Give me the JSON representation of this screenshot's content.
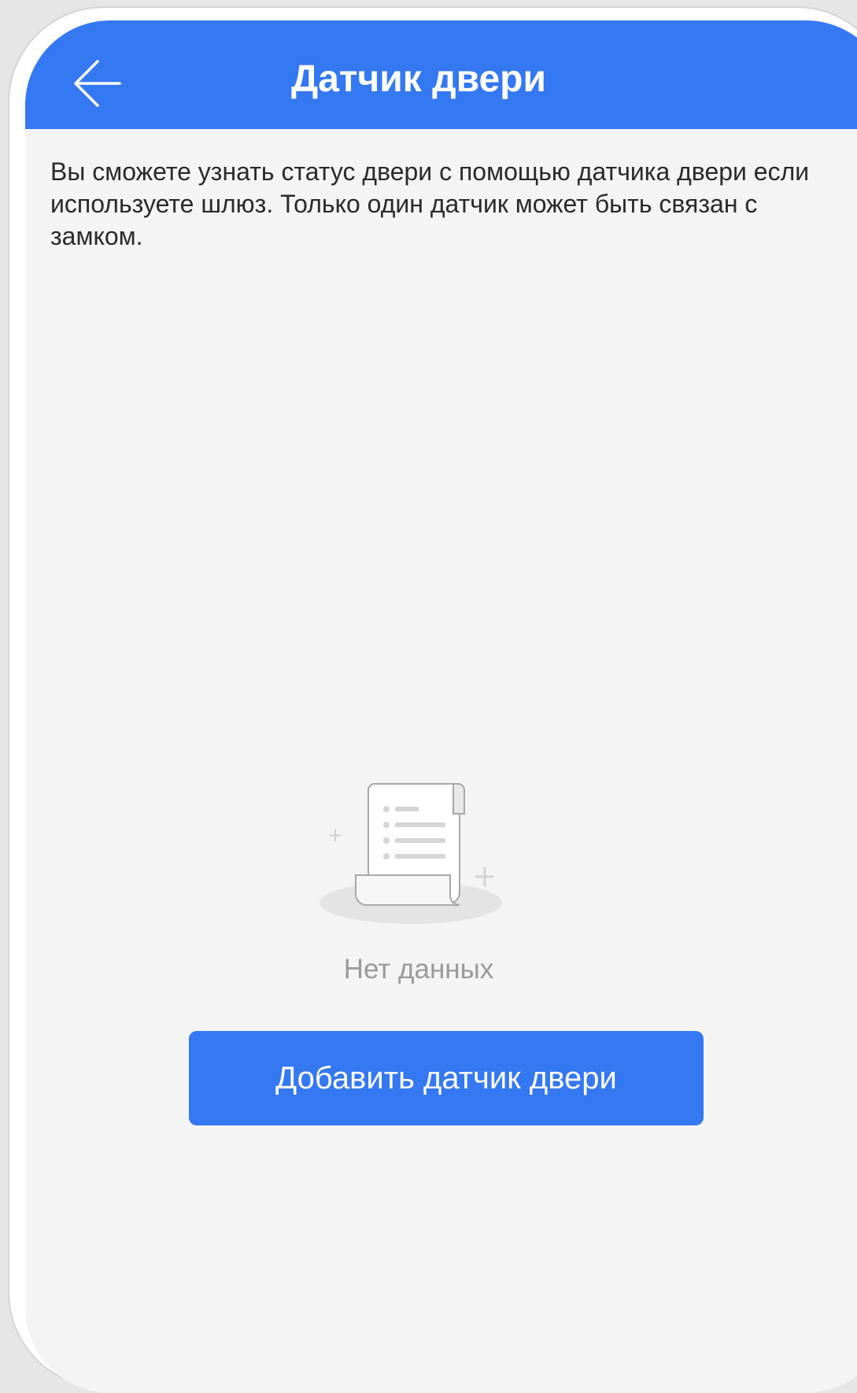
{
  "header": {
    "title": "Датчик двери",
    "back_icon": "arrow-left-icon"
  },
  "description": "Вы сможете узнать статус двери с помощью датчика двери если используете шлюз. Только один датчик может быть связан с замком.",
  "empty_state": {
    "icon": "document-scroll-icon",
    "text": "Нет данных"
  },
  "actions": {
    "add_button_label": "Добавить датчик двери"
  },
  "colors": {
    "accent": "#3478f2",
    "background": "#f4f4f4",
    "text": "#2a2a2a",
    "muted_text": "#9a9a9a"
  }
}
